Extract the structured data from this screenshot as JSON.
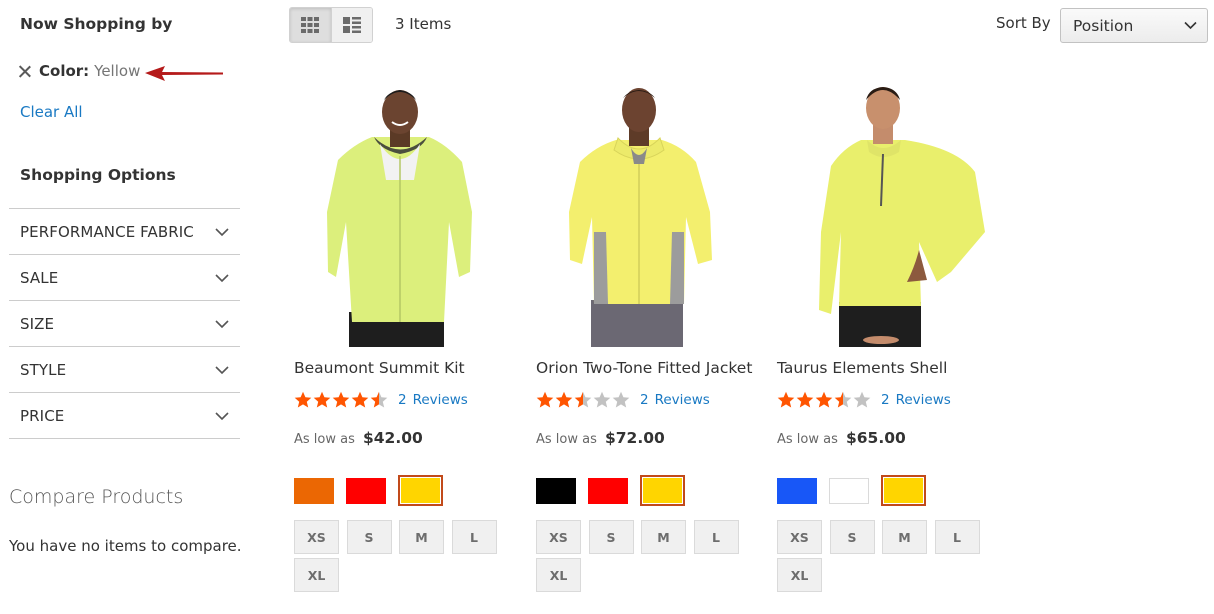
{
  "sidebar": {
    "now_shopping_title": "Now Shopping by",
    "active_filter": {
      "label": "Color:",
      "value": "Yellow"
    },
    "clear_all": "Clear All",
    "shopping_options_title": "Shopping Options",
    "options": [
      {
        "label": "PERFORMANCE FABRIC"
      },
      {
        "label": "SALE"
      },
      {
        "label": "SIZE"
      },
      {
        "label": "STYLE"
      },
      {
        "label": "PRICE"
      }
    ],
    "compare": {
      "title": "Compare Products",
      "empty_text": "You have no items to compare."
    }
  },
  "toolbar": {
    "item_count": "3 Items",
    "sort_label": "Sort By",
    "sort_value": "Position",
    "modes": [
      "grid",
      "list"
    ],
    "active_mode": "grid"
  },
  "colors": {
    "link": "#1979c3",
    "star_filled": "#ff5501",
    "star_empty": "#c2c2c2",
    "arrow": "#b51a1a",
    "swatch_selected_border": "#c24a1a"
  },
  "products": [
    {
      "name": "Beaumont Summit Kit",
      "rating": 4.5,
      "reviews_count": "2",
      "reviews_label": "Reviews",
      "price_label": "As low as",
      "price": "$42.00",
      "colors": [
        {
          "name": "Orange",
          "hex": "#eb6703",
          "selected": false
        },
        {
          "name": "Red",
          "hex": "#ff0000",
          "selected": false
        },
        {
          "name": "Yellow",
          "hex": "#ffd500",
          "selected": true
        }
      ],
      "sizes": [
        "XS",
        "S",
        "M",
        "L",
        "XL"
      ]
    },
    {
      "name": "Orion Two-Tone Fitted Jacket",
      "rating": 2.5,
      "reviews_count": "2",
      "reviews_label": "Reviews",
      "price_label": "As low as",
      "price": "$72.00",
      "colors": [
        {
          "name": "Black",
          "hex": "#000000",
          "selected": false
        },
        {
          "name": "Red",
          "hex": "#ff0000",
          "selected": false
        },
        {
          "name": "Yellow",
          "hex": "#ffd500",
          "selected": true
        }
      ],
      "sizes": [
        "XS",
        "S",
        "M",
        "L",
        "XL"
      ]
    },
    {
      "name": "Taurus Elements Shell",
      "rating": 3.5,
      "reviews_count": "2",
      "reviews_label": "Reviews",
      "price_label": "As low as",
      "price": "$65.00",
      "colors": [
        {
          "name": "Blue",
          "hex": "#1857f7",
          "selected": false
        },
        {
          "name": "White",
          "hex": "#ffffff",
          "selected": false
        },
        {
          "name": "Yellow",
          "hex": "#ffd500",
          "selected": true
        }
      ],
      "sizes": [
        "XS",
        "S",
        "M",
        "L",
        "XL"
      ]
    }
  ]
}
